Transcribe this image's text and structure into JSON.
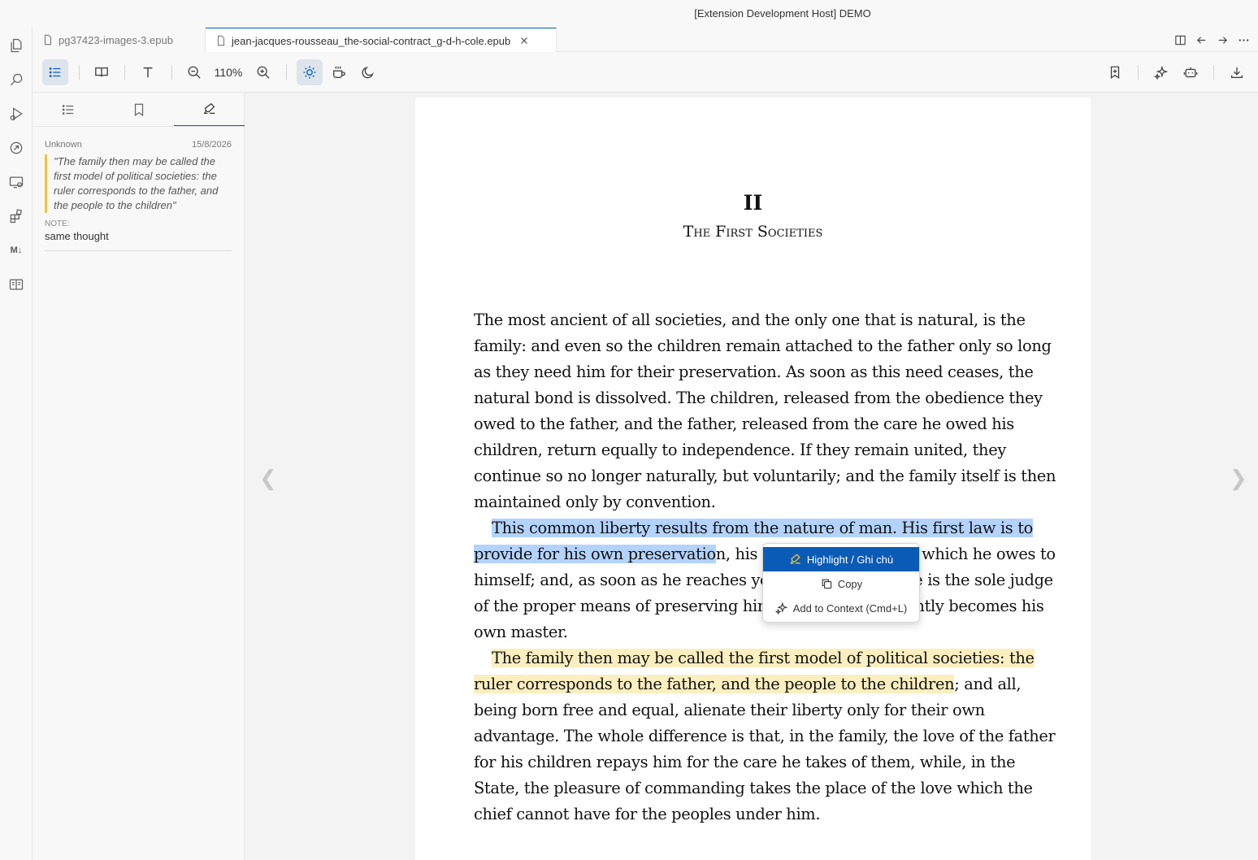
{
  "window": {
    "title": "[Extension Development Host] DEMO"
  },
  "activity_bar": [
    "explorer-icon",
    "search-icon",
    "run-debug-icon",
    "remote-icon",
    "remote-explorer-icon",
    "extensions-icon",
    "markdown-icon",
    "book-icon"
  ],
  "activity_md_label": "M↓",
  "tabs": [
    {
      "label": "pg37423-images-3.epub",
      "active": false
    },
    {
      "label": "jean-jacques-rousseau_the-social-contract_g-d-h-cole.epub",
      "active": true
    }
  ],
  "toolbar": {
    "zoom": "110%",
    "buttons": [
      "toc-icon",
      "book-open-icon",
      "text-icon",
      "zoom-out-icon",
      "zoom-in-icon",
      "sun-icon",
      "coffee-icon",
      "moon-icon",
      "bookmark-add-icon",
      "sparkle-icon",
      "robot-icon",
      "download-icon"
    ]
  },
  "sidebar": {
    "tabs": [
      "list-icon",
      "bookmark-icon",
      "highlighter-icon"
    ],
    "annotation": {
      "author": "Unknown",
      "date": "15/8/2026",
      "quote": "\"The family then may be called the first model of political societies: the ruler corresponds to the father, and the people to the children\"",
      "note_label": "NOTE:",
      "note": "same thought"
    }
  },
  "reader": {
    "prev": "❮",
    "next": "❯",
    "chapter_number": "II",
    "chapter_title": "The First Societies",
    "p1": "The most ancient of all societies, and the only one that is natural, is the family: and even so the children remain attached to the father only so long as they need him for their preservation. As soon as this need ceases, the natural bond is dissolved. The children, released from the obedience they owed to the father, and the father, released from the care he owed his children, return equally to independence. If they remain united, they continue so no longer naturally, but voluntarily; and the family itself is then maintained only by convention.",
    "p2_selected": "This common liberty results from the nature of man. His first law is to provide for his own preservatio",
    "p2_rest": "n, his first cares are those which he owes to himself; and, as soon as he reaches years of discretion, he is the sole judge of the proper means of preserving himself, and consequently becomes his own master.",
    "p3_highlight": "The family then may be called the first model of political societies: the ruler corresponds to the father, and the people to the children",
    "p3_rest": "; and all, being born free and equal, alienate their liberty only for their own advantage. The whole difference is that, in the family, the love of the father for his children repays him for the care he takes of them, while, in the State, the pleasure of commanding takes the place of the love which the chief cannot have for the peoples under him."
  },
  "context_menu": {
    "items": [
      {
        "label": "Highlight / Ghi chú",
        "icon": "highlighter-icon",
        "active": true
      },
      {
        "label": "Copy",
        "icon": "copy-icon",
        "active": false
      },
      {
        "label": "Add to Context (Cmd+L)",
        "icon": "sparkle-icon",
        "active": false
      }
    ]
  },
  "colors": {
    "accent": "#005fb8",
    "selection": "#b3d3fd",
    "highlight": "#fcefbf",
    "menu_active": "#0a5bb6"
  }
}
